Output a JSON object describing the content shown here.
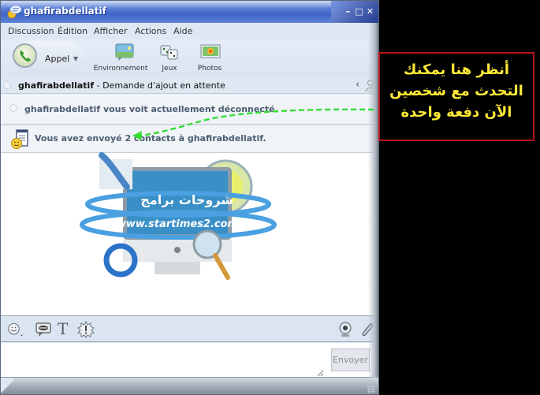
{
  "window": {
    "title": "ghafirabdellatif",
    "controls": {
      "minimize": "–",
      "maximize": "□",
      "close": "✕"
    }
  },
  "menu": [
    "Discussion",
    "Édition",
    "Afficher",
    "Actions",
    "Aide"
  ],
  "toolbar": {
    "call_label": "Appel",
    "call_caret": "▼",
    "environment_label": "Environnement",
    "games_label": "Jeux",
    "photos_label": "Photos"
  },
  "contact": {
    "name": "ghafirabdellatif",
    "status_text": " - Demande d'ajout en attente",
    "collapse_glyph": "‹"
  },
  "conversation": {
    "notices": [
      {
        "icon": "offline-status-icon",
        "text": "ghafirabdellatif vous voit actuellement déconnecté."
      },
      {
        "icon": "contact-card-icon",
        "text": "Vous avez envoyé 2 contacts à ghafirabdellatif."
      }
    ],
    "watermark_url": "www.startimes2.com",
    "watermark_arabic": "شروحات برامج"
  },
  "format_bar": {
    "font_glyph": "T"
  },
  "input": {
    "value": "",
    "placeholder": "",
    "send_label": "Envoyer"
  },
  "annotation": {
    "text": "أنظر هنا يمكنك التحدث مع شخصين الآن دفعة واحدة",
    "text_color": "#ffe936",
    "border_color": "#b4141c",
    "arrow_color": "#33dd33"
  }
}
